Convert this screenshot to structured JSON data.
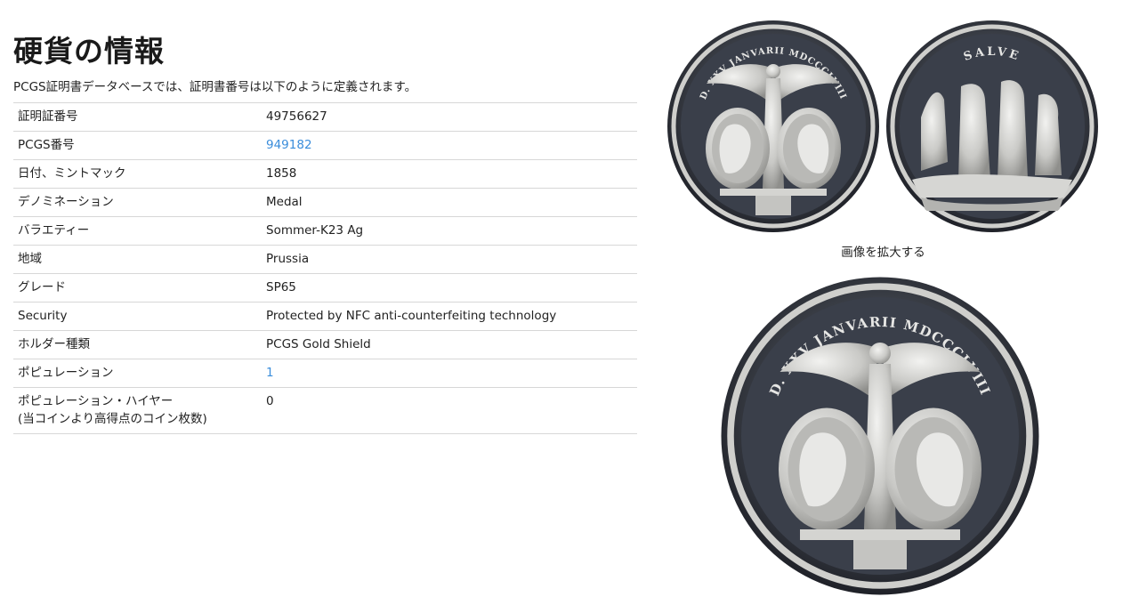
{
  "coin_info": {
    "title": "硬貨の情報",
    "intro": "PCGS証明書データベースでは、証明書番号は以下のように定義されます。",
    "rows": [
      {
        "label": "証明証番号",
        "value": "49756627",
        "link": false
      },
      {
        "label": "PCGS番号",
        "value": "949182",
        "link": true
      },
      {
        "label": "日付、ミントマック",
        "value": "1858",
        "link": false
      },
      {
        "label": "デノミネーション",
        "value": "Medal",
        "link": false
      },
      {
        "label": "バラエティー",
        "value": "Sommer-K23 Ag",
        "link": false
      },
      {
        "label": "地域",
        "value": "Prussia",
        "link": false
      },
      {
        "label": "グレード",
        "value": "SP65",
        "link": false
      },
      {
        "label": "Security",
        "value": "Protected by NFC anti-counterfeiting technology",
        "link": false
      },
      {
        "label": "ホルダー種類",
        "value": "PCGS Gold Shield",
        "link": false
      },
      {
        "label": "ポピュレーション",
        "value": "1",
        "link": true
      },
      {
        "label": "ポピュレーション・ハイヤー",
        "label_sub": "(当コインより高得点のコイン枚数)",
        "value": "0",
        "link": false
      }
    ]
  },
  "images": {
    "obverse_legend": "D. XXV JANVARII MDCCCLVIII",
    "reverse_legend": "SALVE",
    "enlarge_label": "画像を拡大する"
  },
  "colors": {
    "link": "#3a8ddb",
    "border": "#d7d7d7",
    "text": "#222222"
  }
}
